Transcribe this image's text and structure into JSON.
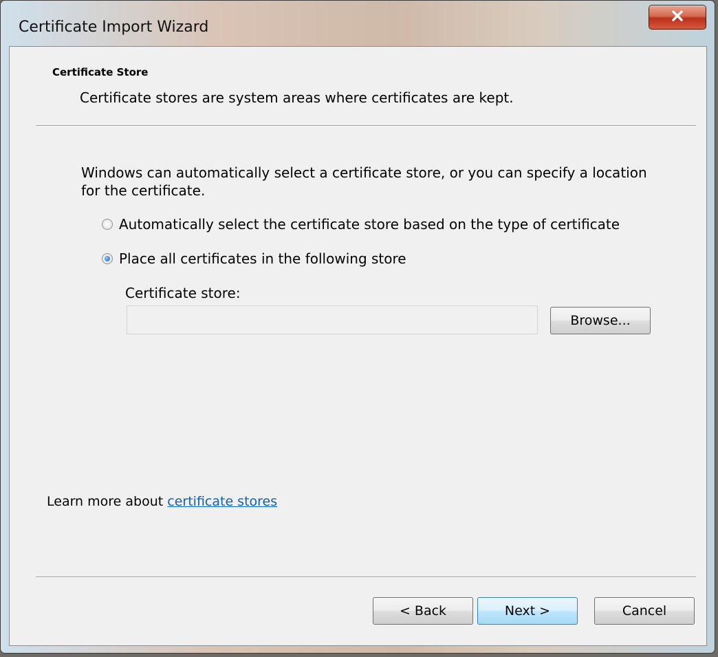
{
  "window": {
    "title": "Certificate Import Wizard",
    "close_label": "X"
  },
  "header": {
    "section_title": "Certificate Store",
    "section_subtitle": "Certificate stores are system areas where certificates are kept."
  },
  "body": {
    "intro": "Windows can automatically select a certificate store, or you can specify a location for the certificate.",
    "options": [
      {
        "label": "Automatically select the certificate store based on the type of certificate",
        "selected": false
      },
      {
        "label": "Place all certificates in the following store",
        "selected": true
      }
    ],
    "store_label": "Certificate store:",
    "store_value": "",
    "browse_label": "Browse...",
    "learn_prefix": "Learn more about ",
    "learn_link": "certificate stores"
  },
  "footer": {
    "back_label": "< Back",
    "next_label": "Next >",
    "cancel_label": "Cancel"
  },
  "colors": {
    "link": "#0b63b6",
    "close_button": "#c8432b",
    "client_background": "#f0f0f0"
  }
}
